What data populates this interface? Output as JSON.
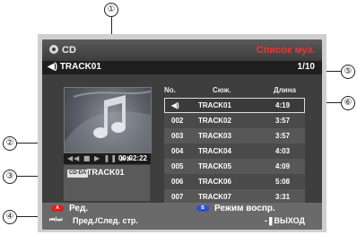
{
  "callouts": [
    "①",
    "②",
    "③",
    "④",
    "⑤",
    "⑥"
  ],
  "header": {
    "app_title": "CD",
    "mode_label": "Список муз."
  },
  "trackbar": {
    "current_track": "TRACK01",
    "page": "1/10"
  },
  "player": {
    "controls": "◀◀ ■ ▶ ❚❚ ▶▶",
    "elapsed": "00:02:22"
  },
  "info": {
    "badge": "CD-DA",
    "track": "TRACK01"
  },
  "list": {
    "headers": {
      "no": "No.",
      "title": "Сюж.",
      "length": "Длина"
    },
    "selected_index": 0,
    "rows": [
      {
        "no": "◀)",
        "title": "TRACK01",
        "length": "4:19"
      },
      {
        "no": "002",
        "title": "TRACK02",
        "length": "3:57"
      },
      {
        "no": "003",
        "title": "TRACK03",
        "length": "3:57"
      },
      {
        "no": "004",
        "title": "TRACK04",
        "length": "4:03"
      },
      {
        "no": "005",
        "title": "TRACK05",
        "length": "4:09"
      },
      {
        "no": "006",
        "title": "TRACK06",
        "length": "5:08"
      },
      {
        "no": "007",
        "title": "TRACK07",
        "length": "3:31"
      }
    ]
  },
  "footer": {
    "key_a": "A",
    "key_a_label": "Ред.",
    "key_b": "B",
    "key_b_label": "Режим воспр.",
    "skip_icon": "⏮/⏭",
    "page_label": "Пред./След. стр.",
    "exit_label": "ВЫХОД"
  },
  "colors": {
    "mode_label": "#ff2e2e",
    "key_a": "#e02020",
    "key_b": "#3050d0"
  }
}
